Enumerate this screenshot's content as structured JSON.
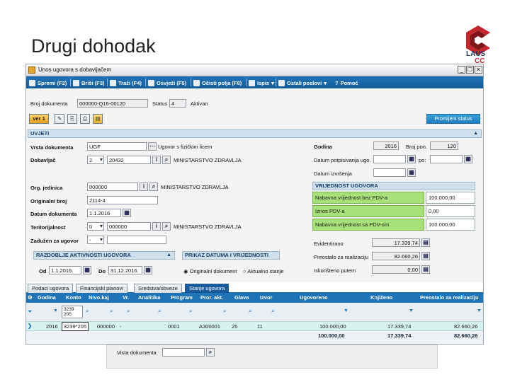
{
  "slide": {
    "title": "Drugi dohodak"
  },
  "logo": {
    "line1": "LAUS",
    "line2": "CC"
  },
  "window": {
    "title": "Unos ugovora s dobavljačem",
    "controls": {
      "minimize": "_",
      "restore": "☐",
      "close": "✕"
    }
  },
  "toolbar": {
    "items": [
      "Spremi (F2)",
      "Briši (F3)",
      "Traži (F4)",
      "Osvježi (F5)",
      "Očisti polja (F8)",
      "Ispis",
      "Ostali poslovi",
      "Pomoć"
    ]
  },
  "document": {
    "number_label": "Broj dokumenta",
    "number_value": "000000-Q16-00120",
    "status_label": "Status",
    "status_value": "4",
    "status_text": "Aktivan",
    "action_btn_label": "ver 1",
    "change_status_label": "Promijeni status"
  },
  "conditions": {
    "section_title": "UVJETI",
    "vrsta_dokumenta_label": "Vrsta dokumenta",
    "vrsta_dokumenta_value": "UGF",
    "vrsta_dokumenta_desc": "Ugovor s fizičkim licem",
    "dobavljac_label": "Dobavljač",
    "dobavljac_type": "2",
    "dobavljac_code": "20432",
    "dobavljac_name": "MINISTARSTVO ZDRAVLJA",
    "org_jedinica_label": "Org. jedinica",
    "org_jedinica_value": "000000",
    "org_jedinica_name": "MINISTARSTVO ZDRAVLJA",
    "originalni_broj_label": "Originalni broj",
    "originalni_broj_value": "2114-4",
    "datum_dokumenta_label": "Datum dokumenta",
    "datum_dokumenta_value": "1.1.2016",
    "teritorijalno_label": "Teritorijalnost",
    "teritorijalno_type": "0",
    "teritorijalno_code": "000000",
    "teritorijalno_name": "MINISTARSTVO ZDRAVLJA",
    "zaduzen_label": "Zadužen za ugovor",
    "zaduzen_value": "-"
  },
  "right_panel": {
    "godina_label": "Godina",
    "godina_value": "2016",
    "broj_label": "Broj pon.",
    "broj_value": "120",
    "datum_potpisivanja_label": "Datum potpisivanja ugo.",
    "datum_potpisivanja_suffix": "po:",
    "datum_izvrsenja_label": "Datum izvršenja",
    "vrijednost_title": "VRIJEDNOST UGOVORA",
    "rows": [
      {
        "label": "Nabavna vrijednost bez PDV-a",
        "value": "100.000,00"
      },
      {
        "label": "Iznos PDV-a",
        "value": "0,00"
      },
      {
        "label": "Nabavna vrijednost sa PDV-om",
        "value": "100.000,00"
      }
    ],
    "evidentirano_label": "Evidentirano",
    "evidentirano_value": "17.339,74",
    "preostalo_label": "Preostalo za realizaciju",
    "preostalo_value": "82.660,26",
    "iskoristeno_label": "Iskorišteno putem",
    "iskoristeno_value": "0,00"
  },
  "razdoblje": {
    "title": "RAZDOBLJE AKTIVNOSTI UGOVORA",
    "od_label": "Od",
    "od_value": "1.1.2016.",
    "do_label": "Do",
    "do_value": "31.12.2016."
  },
  "prikaz": {
    "title": "PRIKAZ DATUMA I VRIJEDNOSTI",
    "option1": "Originalni dokument",
    "option2": "Aktualno stanje"
  },
  "tabs": [
    "Podaci ugovora",
    "Financijski planovi",
    "Sredstva/obveze",
    "Stanje ugovora"
  ],
  "grid": {
    "columns": [
      "Godina",
      "Konto",
      "Nivo.kaj",
      "Vr.",
      "Analitika",
      "Program",
      "Pror. akt.",
      "Glava",
      "Izvor",
      "Ugovoreno",
      "Knjiženo",
      "Preostalo za realizaciju"
    ],
    "filter_konto": "3239 205",
    "row": {
      "godina": "2016",
      "konto": "3239*205",
      "nivo": "000000",
      "vr": "-",
      "analitika": "",
      "program": "0001",
      "pror_akt": "A300001",
      "glava": "25",
      "izvor": "11",
      "ugovoreno": "100.000,00",
      "knjizeno": "17.339,74",
      "preostalo": "82.660,26"
    },
    "sum": {
      "ugovoreno": "100.000,00",
      "knjizeno": "17.339,74",
      "preostalo": "82.660,26"
    }
  },
  "underlay": {
    "label": "Vista dokumenta"
  },
  "colors": {
    "toolbar": "#1f74b8",
    "section": "#cfe0ee",
    "green": "#a8e07a",
    "row": "#d7f3ef"
  }
}
